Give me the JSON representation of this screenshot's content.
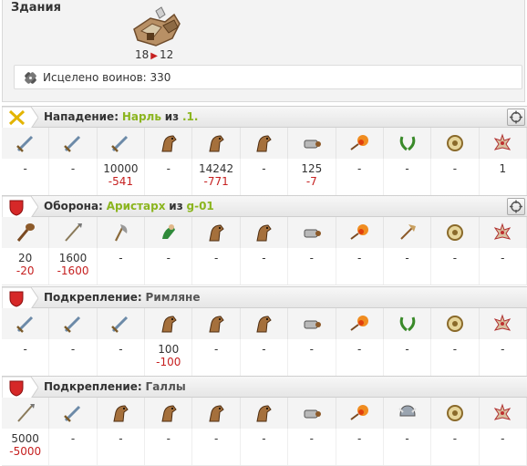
{
  "buildings": {
    "title": "Здания",
    "level_from": "18",
    "level_to": "12",
    "healed_label": "Исцелено воинов: 330"
  },
  "sections": {
    "attack": {
      "role": "Нападение:",
      "player": "Нарль",
      "of": "из",
      "alliance": ".1.",
      "counts": [
        "-",
        "-",
        "10000",
        "-",
        "14242",
        "-",
        "125",
        "-",
        "-",
        "-",
        "1"
      ],
      "losses": [
        "",
        "",
        "-541",
        "",
        "-771",
        "",
        "-7",
        "",
        "",
        "",
        ""
      ]
    },
    "defense": {
      "role": "Оборона:",
      "player": "Аристарх",
      "of": "из",
      "alliance": "g-01",
      "counts": [
        "20",
        "1600",
        "-",
        "-",
        "-",
        "-",
        "-",
        "-",
        "-",
        "-",
        "-"
      ],
      "losses": [
        "-20",
        "-1600",
        "",
        "",
        "",
        "",
        "",
        "",
        "",
        "",
        ""
      ]
    },
    "reinf1": {
      "role": "Подкрепление:",
      "tribe": "Римляне",
      "counts": [
        "-",
        "-",
        "-",
        "100",
        "-",
        "-",
        "-",
        "-",
        "-",
        "-",
        "-"
      ],
      "losses": [
        "",
        "",
        "",
        "-100",
        "",
        "",
        "",
        "",
        "",
        "",
        ""
      ]
    },
    "reinf2": {
      "role": "Подкрепление:",
      "tribe": "Галлы",
      "counts": [
        "5000",
        "-",
        "-",
        "-",
        "-",
        "-",
        "-",
        "-",
        "-",
        "-",
        "-"
      ],
      "losses": [
        "-5000",
        "",
        "",
        "",
        "",
        "",
        "",
        "",
        "",
        "",
        ""
      ]
    }
  },
  "colors": {
    "loss": "#c62020",
    "player": "#8bb51f",
    "attack_badge": "#f2c200",
    "defense_badge": "#d62828"
  },
  "icons": {
    "attack_units": [
      "sword-icon",
      "sword-icon",
      "sword-icon",
      "horse-icon",
      "horse-icon",
      "horse-icon",
      "ram-icon",
      "catapult-icon",
      "laurel-icon",
      "shield-icon",
      "hero-icon"
    ],
    "defense_units": [
      "club-icon",
      "spear-icon",
      "axe-icon",
      "scout-icon",
      "horse-icon",
      "horse-icon",
      "ram-icon",
      "catapult-icon",
      "chief-icon",
      "shield-icon",
      "hero-icon"
    ],
    "reinf1_units": [
      "sword-icon",
      "sword-icon",
      "sword-icon",
      "horse-icon",
      "horse-icon",
      "horse-icon",
      "ram-icon",
      "catapult-icon",
      "laurel-icon",
      "shield-icon",
      "hero-icon"
    ],
    "reinf2_units": [
      "spear-icon",
      "sword-icon",
      "horse-icon",
      "horse-icon",
      "horse-icon",
      "horse-icon",
      "ram-icon",
      "catapult-icon",
      "helmet-icon",
      "shield-icon",
      "hero-icon"
    ]
  }
}
